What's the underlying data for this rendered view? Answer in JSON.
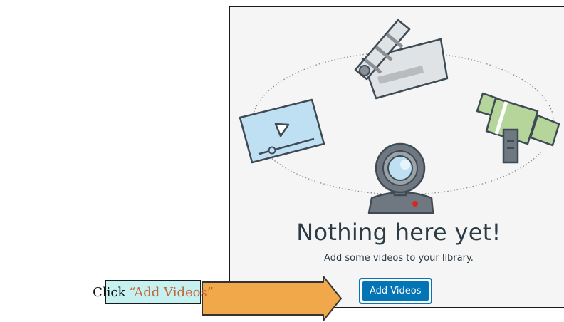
{
  "empty_state": {
    "title": "Nothing here yet!",
    "message": "Add some videos to your library.",
    "add_button_label": "Add Videos",
    "icons": [
      "clapperboard-icon",
      "video-player-icon",
      "video-camera-icon",
      "webcam-icon"
    ]
  },
  "callout": {
    "lead": "Click",
    "quote": "“Add Videos”",
    "arrow_icon": "right-arrow-icon"
  },
  "colors": {
    "button_blue": "#0374b5",
    "callout_bg": "#c6f1f1",
    "callout_quote": "#c4633a",
    "arrow_fill": "#f0a84a",
    "camera_green": "#b6d59b",
    "player_blue": "#bfe0f3"
  }
}
